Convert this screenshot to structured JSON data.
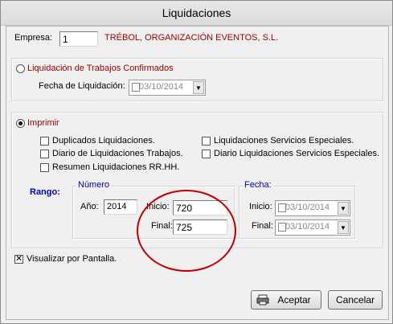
{
  "window": {
    "title": "Liquidaciones"
  },
  "empresa": {
    "label": "Empresa:",
    "value": "1",
    "name": "TRÉBOL, ORGANIZACIÓN EVENTOS, S.L."
  },
  "trabajos": {
    "radio_label": "Liquidación de Trabajos Confirmados",
    "fecha_label": "Fecha de Liquidación:",
    "fecha_value": "03/10/2014"
  },
  "imprimir": {
    "radio_label": "Imprimir",
    "options": [
      "Duplicados Liquidaciones.",
      "Diario de Liquidaciones Trabajos.",
      "Resumen Liquidaciones RR.HH.",
      "Liquidaciones Servicios Especiales.",
      "Diario Liquidaciones Servicios Especiales."
    ]
  },
  "rango": {
    "label": "Rango:",
    "numero": {
      "legend": "Número",
      "year_label": "Año:",
      "year_value": "2014",
      "inicio_label": "Inicio:",
      "inicio_value": "720",
      "final_label": "Final:",
      "final_value": "725"
    },
    "fecha": {
      "legend": "Fecha:",
      "inicio_label": "Inicio:",
      "inicio_value": "03/10/2014",
      "final_label": "Final:",
      "final_value": "03/10/2014"
    }
  },
  "visualizar": {
    "label": "Visualizar por Pantalla."
  },
  "buttons": {
    "printer_icon": "printer-icon",
    "aceptar": "Aceptar",
    "cancelar": "Cancelar"
  },
  "colors": {
    "empresa_name": "#a00000",
    "legend": "#0000c0",
    "highlight_ellipse": "#c00000"
  }
}
